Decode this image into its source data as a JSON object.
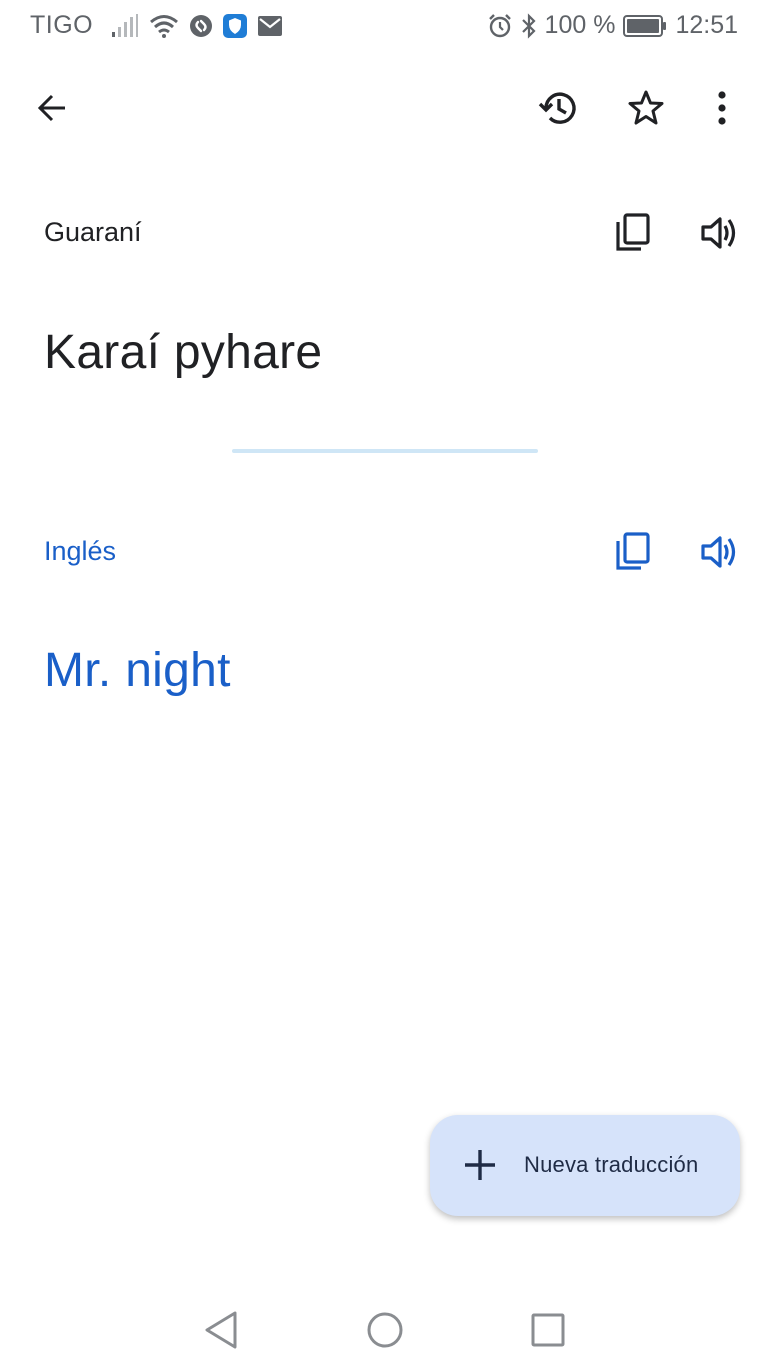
{
  "status_bar": {
    "carrier": "TIGO",
    "battery": "100 %",
    "time": "12:51",
    "icons_left": [
      "signal-icon",
      "wifi-icon",
      "shazam-icon",
      "vpn-shield-icon",
      "mail-icon"
    ],
    "icons_right": [
      "alarm-icon",
      "bluetooth-icon",
      "battery-icon"
    ]
  },
  "toolbar": {
    "icons": [
      "back-arrow-icon",
      "history-icon",
      "star-icon",
      "more-vert-icon"
    ]
  },
  "source": {
    "language": "Guaraní",
    "text": "Karaí pyhare",
    "icons": [
      "copy-icon",
      "speaker-icon"
    ]
  },
  "target": {
    "language": "Inglés",
    "text": "Mr. night",
    "icons": [
      "copy-icon",
      "speaker-icon"
    ]
  },
  "fab": {
    "label": "Nueva traducción",
    "icon": "plus-icon"
  },
  "nav_bar": {
    "icons": [
      "nav-back-icon",
      "nav-home-icon",
      "nav-recents-icon"
    ]
  },
  "colors": {
    "accent_blue": "#1a5fc8",
    "fab_background": "#d6e3fa",
    "divider": "#cfe6f6",
    "text_primary": "#202124",
    "status_gray": "#5f6368"
  }
}
